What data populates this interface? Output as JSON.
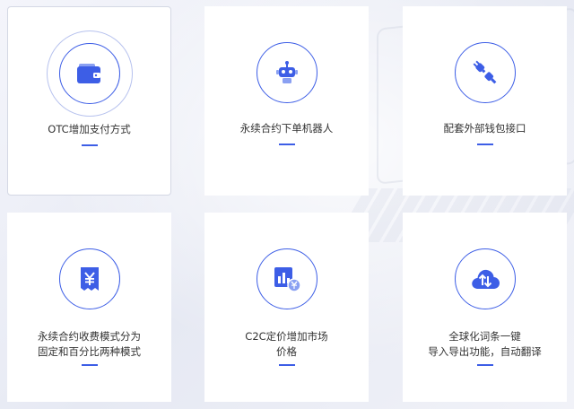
{
  "features": [
    {
      "label": "OTC增加支付方式",
      "icon": "wallet-icon"
    },
    {
      "label": "永续合约下单机器人",
      "icon": "robot-icon"
    },
    {
      "label": "配套外部钱包接口",
      "icon": "plug-icon"
    },
    {
      "label_line1": "永续合约收费模式分为",
      "label_line2": "固定和百分比两种模式",
      "icon": "yen-receipt-icon"
    },
    {
      "label_line1": "C2C定价增加市场",
      "label_line2": "价格",
      "icon": "price-chart-icon"
    },
    {
      "label_line1": "全球化词条一键",
      "label_line2": "导入导出功能，自动翻译",
      "icon": "cloud-transfer-icon"
    }
  ],
  "colors": {
    "accent": "#3d5ee6",
    "text": "#333333",
    "card": "#ffffff"
  }
}
